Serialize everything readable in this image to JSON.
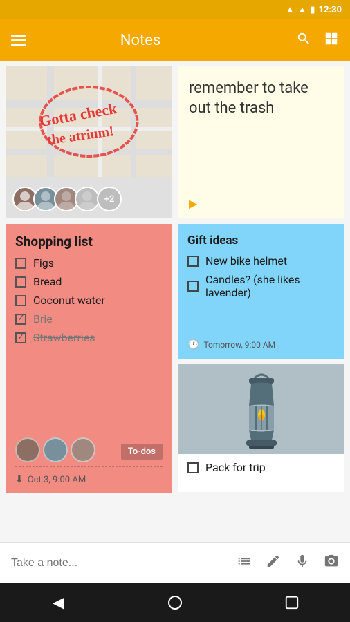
{
  "statusBar": {
    "time": "12:30"
  },
  "topBar": {
    "title": "Notes"
  },
  "bottomBar": {
    "placeholder": "Take a note..."
  },
  "notes": {
    "mapNote": {
      "avatarCount": "+2"
    },
    "trashNote": {
      "text": "remember to take out the trash"
    },
    "shoppingNote": {
      "title": "Shopping list",
      "items": [
        {
          "text": "Figs",
          "checked": false,
          "strikethrough": false
        },
        {
          "text": "Bread",
          "checked": false,
          "strikethrough": false
        },
        {
          "text": "Coconut water",
          "checked": false,
          "strikethrough": false
        },
        {
          "text": "Brie",
          "checked": true,
          "strikethrough": true
        },
        {
          "text": "Strawberries",
          "checked": true,
          "strikethrough": true
        }
      ],
      "todoBadge": "To-dos",
      "reminder": "Oct 3, 9:00 AM"
    },
    "giftNote": {
      "title": "Gift ideas",
      "items": [
        {
          "text": "New bike helmet",
          "checked": false
        },
        {
          "text": "Candles? (she likes lavender)",
          "checked": false
        }
      ],
      "reminder": "Tomorrow, 9:00 AM"
    },
    "tripNote": {
      "checkboxText": "Pack for trip"
    }
  },
  "navBar": {
    "back": "◀",
    "home": "○",
    "recent": "□"
  }
}
